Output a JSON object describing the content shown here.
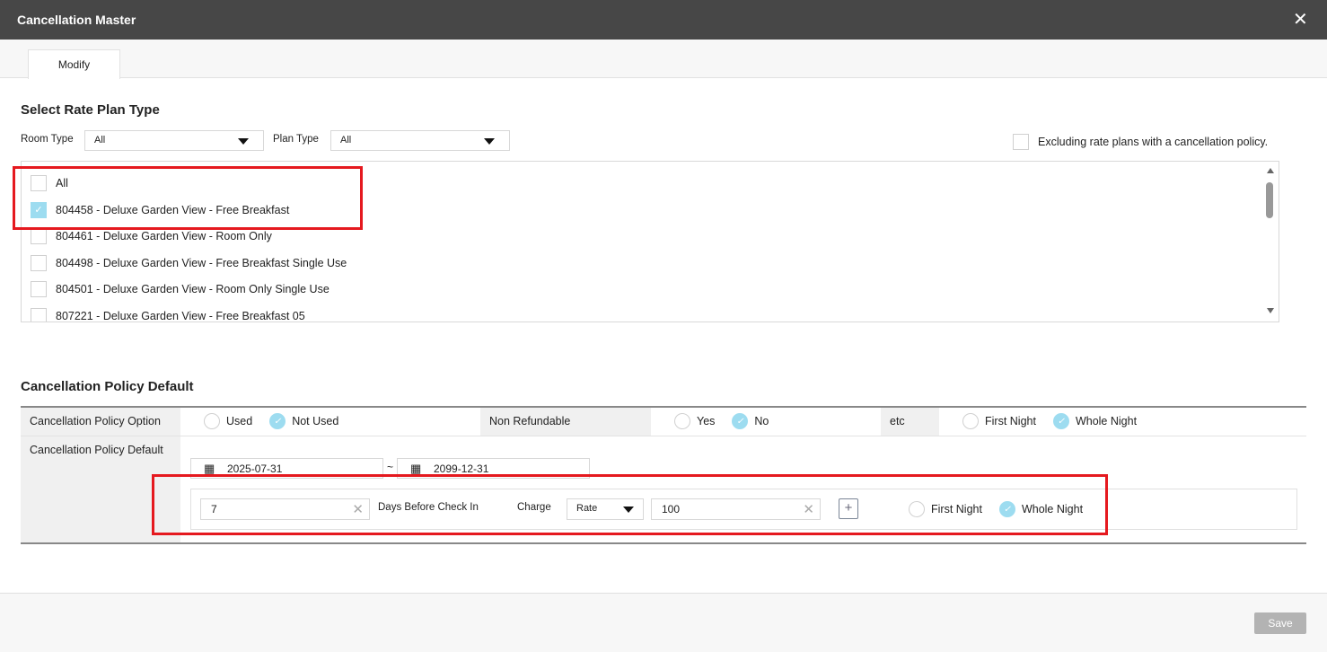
{
  "window": {
    "title": "Cancellation Master",
    "close_icon": "close-icon"
  },
  "tabs": [
    {
      "label": "Modify",
      "active": true
    }
  ],
  "rate_plan": {
    "title": "Select Rate Plan Type",
    "room_type_label": "Room Type",
    "room_type_value": "All",
    "plan_type_label": "Plan Type",
    "plan_type_value": "All",
    "exclude_label": "Excluding rate plans with a cancellation policy.",
    "exclude_checked": false,
    "items": [
      {
        "label": "All",
        "checked": false
      },
      {
        "label": "804458 - Deluxe Garden View - Free Breakfast",
        "checked": true
      },
      {
        "label": "804461 - Deluxe Garden View - Room Only",
        "checked": false
      },
      {
        "label": "804498 - Deluxe Garden View - Free Breakfast Single Use",
        "checked": false
      },
      {
        "label": "804501 - Deluxe Garden View - Room Only Single Use",
        "checked": false
      },
      {
        "label": "807221 - Deluxe Garden View - Free Breakfast 05",
        "checked": false
      }
    ]
  },
  "policy": {
    "title": "Cancellation Policy Default",
    "option_label": "Cancellation Policy Option",
    "used": "Used",
    "not_used": "Not Used",
    "non_refundable_label": "Non Refundable",
    "yes": "Yes",
    "no": "No",
    "etc_label": "etc",
    "first_night": "First Night",
    "whole_night": "Whole Night",
    "default_label": "Cancellation Policy Default",
    "date_from": "2025-07-31",
    "date_sep": "~",
    "date_to": "2099-12-31",
    "days_value": "7",
    "days_label": "Days Before Check In",
    "charge_label": "Charge",
    "charge_type": "Rate",
    "charge_value": "100",
    "add_label": "+",
    "rule_first_night": "First Night",
    "rule_whole_night": "Whole Night"
  },
  "footer": {
    "save_label": "Save"
  }
}
